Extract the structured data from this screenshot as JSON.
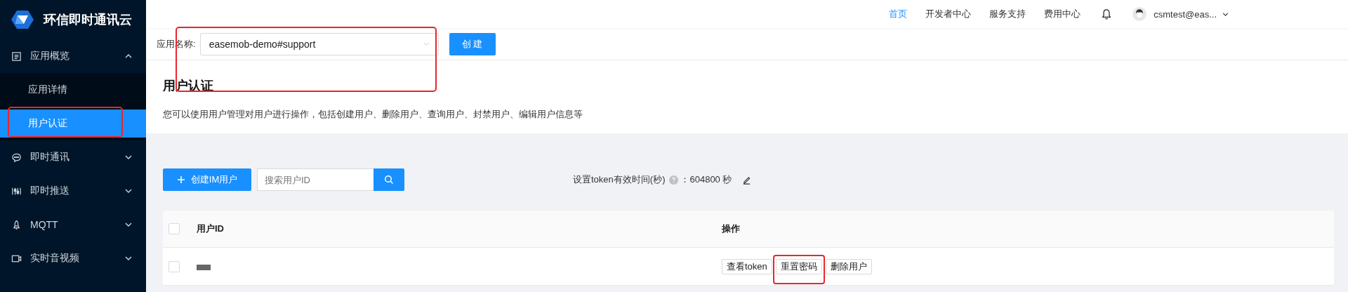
{
  "brand": {
    "name": "环信即时通讯云"
  },
  "sidebar": {
    "items": [
      {
        "label": "应用概览",
        "expanded": true,
        "children": [
          {
            "label": "应用详情",
            "selected": false,
            "highlighted": false
          },
          {
            "label": "用户认证",
            "selected": true,
            "highlighted": true
          }
        ]
      },
      {
        "label": "即时通讯",
        "expanded": false
      },
      {
        "label": "即时推送",
        "expanded": false
      },
      {
        "label": "MQTT",
        "expanded": false
      },
      {
        "label": "实时音视频",
        "expanded": false
      }
    ]
  },
  "header": {
    "nav": [
      {
        "label": "首页",
        "selected": true
      },
      {
        "label": "开发者中心",
        "selected": false
      },
      {
        "label": "服务支持",
        "selected": false
      },
      {
        "label": "费用中心",
        "selected": false
      }
    ],
    "user": {
      "name": "csmtest@eas..."
    }
  },
  "app_bar": {
    "label": "应用名称:",
    "value": "easemob-demo#support",
    "highlighted": true,
    "button": "创 建"
  },
  "page": {
    "title": "用户认证",
    "description": "您可以使用用户管理对用户进行操作，包括创建用户、删除用户、查询用户、封禁用户、编辑用户信息等"
  },
  "toolbar": {
    "create_button": "创建IM用户",
    "search": {
      "placeholder": "搜索用户ID"
    },
    "token_label": "设置token有效时间(秒)",
    "token_value": "：604800 秒"
  },
  "table": {
    "select_all": {
      "checked": false
    },
    "columns": [
      {
        "label": "用户ID"
      },
      {
        "label": "操作"
      }
    ],
    "rows": [
      {
        "checked": false,
        "redacted": true,
        "actions": [
          {
            "label": "查看token",
            "highlighted": false
          },
          {
            "label": "重置密码",
            "highlighted": true
          },
          {
            "label": "删除用户",
            "highlighted": false
          }
        ]
      }
    ]
  }
}
